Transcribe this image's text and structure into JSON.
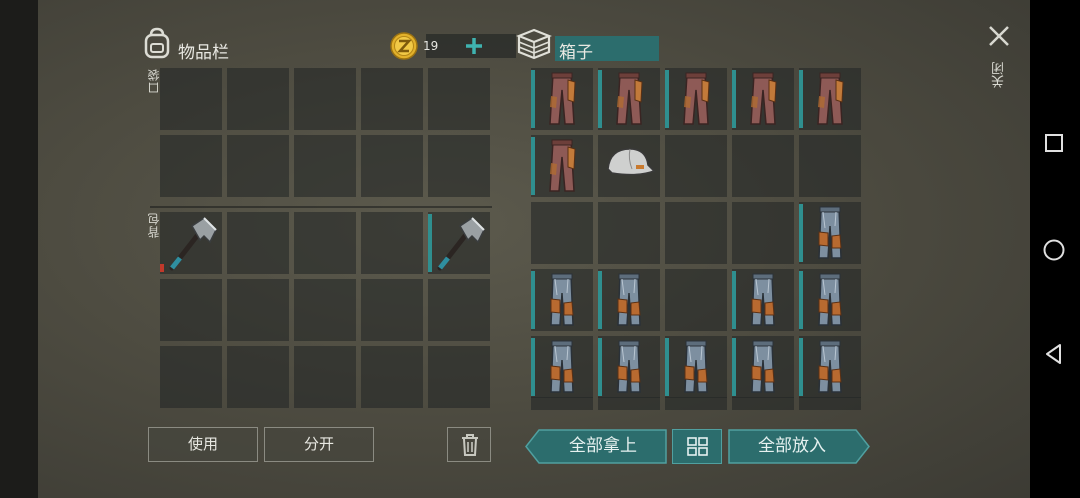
{
  "inventory": {
    "title": "物品栏",
    "coins": "19",
    "pocket_label": "口袋",
    "backpack_label": "背包",
    "use_button": "使用",
    "split_button": "分开"
  },
  "box": {
    "title": "箱子",
    "take_all": "全部拿上",
    "put_all": "全部放入"
  },
  "close_label": "关闭",
  "colors": {
    "accent": "#2c6d6d",
    "marker": "#2f8f8f",
    "coin": "#d8a521"
  },
  "box_items": [
    "leather-pants",
    "leather-pants",
    "leather-pants",
    "leather-pants",
    "leather-pants",
    "leather-pants",
    "cap",
    "",
    "",
    "",
    "",
    "",
    "",
    "",
    "denim-pants",
    "denim-pants",
    "denim-pants",
    "",
    "denim-pants",
    "denim-pants",
    "denim-pants",
    "denim-pants",
    "denim-pants",
    "denim-pants",
    "denim-pants"
  ],
  "backpack_items": [
    "hatchet",
    "",
    "",
    "",
    "hatchet"
  ]
}
